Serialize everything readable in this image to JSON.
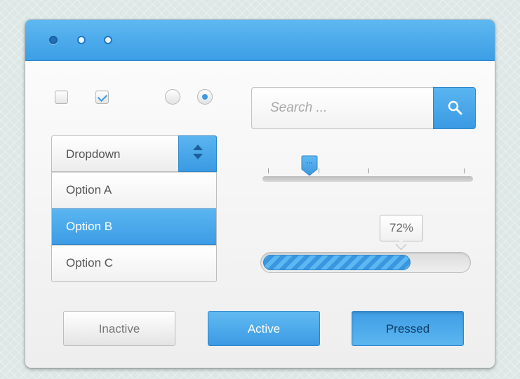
{
  "window": {
    "title_dots": [
      "filled",
      "empty",
      "empty"
    ]
  },
  "controls": {
    "checkboxes": [
      {
        "checked": false
      },
      {
        "checked": true
      }
    ],
    "radios": [
      {
        "selected": false
      },
      {
        "selected": true
      }
    ]
  },
  "dropdown": {
    "label": "Dropdown",
    "options": [
      "Option A",
      "Option B",
      "Option C"
    ],
    "selected_index": 1
  },
  "search": {
    "placeholder": "Search ...",
    "icon": "search-icon"
  },
  "slider": {
    "value_fraction": 0.22,
    "tick_count": 4
  },
  "progress": {
    "label": "72%",
    "value": 72
  },
  "buttons": {
    "inactive_label": "Inactive",
    "active_label": "Active",
    "pressed_label": "Pressed"
  },
  "colors": {
    "accent": "#3c9ee6",
    "accent_dark": "#2f86c9",
    "border": "#bdbdbd"
  }
}
